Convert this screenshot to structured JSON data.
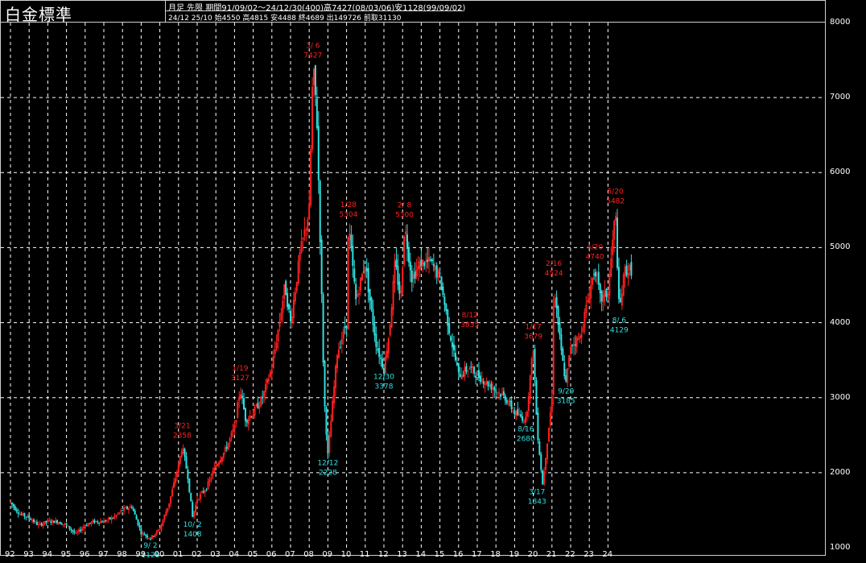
{
  "header": {
    "title": "白金標準",
    "line1": "月足 先限  期間91/09/02～24/12/30(400)高7427(08/03/06)安1128(99/09/02)",
    "line2": "24/12 25/10 始4550 高4815 安4488 終4689 出149726 前取31130"
  },
  "colors": {
    "up": "#ff2020",
    "down": "#30e0e0",
    "grid": "#ffffff",
    "background": "#000000"
  },
  "chart_data": {
    "type": "line",
    "title": "白金標準",
    "ylim": [
      1000,
      8000
    ],
    "y_ticks": [
      1000,
      2000,
      3000,
      4000,
      5000,
      6000,
      7000,
      8000
    ],
    "y_tick_labels": [
      "1000",
      "2000",
      "3000",
      "4000",
      "5000",
      "6000",
      "7000",
      "8000"
    ],
    "x_tick_labels": [
      "92",
      "93",
      "94",
      "95",
      "96",
      "97",
      "98",
      "99",
      "00",
      "01",
      "02",
      "03",
      "04",
      "05",
      "06",
      "07",
      "08",
      "09",
      "10",
      "11",
      "12",
      "13",
      "14",
      "15",
      "16",
      "17",
      "18",
      "19",
      "20",
      "21",
      "22",
      "23",
      "24"
    ],
    "grid": true,
    "series": [
      {
        "x": [
          1992.0,
          1992.5,
          1993.0,
          1993.5,
          1994.0,
          1994.5,
          1995.0,
          1995.5,
          1996.0,
          1996.5,
          1997.0,
          1997.5,
          1998.0,
          1998.5,
          1999.0,
          1999.5,
          2000.0,
          2000.5,
          2001.0,
          2001.2,
          2001.5,
          2001.75,
          2002.0,
          2002.5,
          2003.0,
          2003.5,
          2004.0,
          2004.3,
          2004.6,
          2005.0,
          2005.5,
          2006.0,
          2006.4,
          2006.7,
          2007.0,
          2007.5,
          2008.0,
          2008.2,
          2008.4,
          2008.6,
          2008.8,
          2009.0,
          2009.5,
          2010.0,
          2010.1,
          2010.5,
          2011.0,
          2011.3,
          2011.6,
          2012.0,
          2012.3,
          2012.6,
          2012.9,
          2013.1,
          2013.5,
          2014.0,
          2014.5,
          2015.0,
          2015.5,
          2016.0,
          2016.6,
          2017.0,
          2017.5,
          2018.0,
          2018.5,
          2019.0,
          2019.6,
          2020.0,
          2020.2,
          2020.5,
          2021.0,
          2021.1,
          2021.5,
          2021.75,
          2022.0,
          2022.5,
          2023.0,
          2023.3,
          2023.6,
          2024.0,
          2024.4,
          2024.6,
          2024.9
        ],
        "y": [
          1600,
          1450,
          1400,
          1300,
          1350,
          1350,
          1300,
          1180,
          1300,
          1350,
          1350,
          1400,
          1500,
          1550,
          1200,
          1128,
          1250,
          1600,
          2100,
          2358,
          1950,
          1408,
          1650,
          1800,
          2100,
          2300,
          2600,
          3127,
          2700,
          2800,
          3000,
          3400,
          4000,
          4500,
          4000,
          4900,
          5500,
          7427,
          6800,
          5000,
          3000,
          2228,
          3600,
          4000,
          5304,
          4300,
          4800,
          4200,
          3700,
          3378,
          3900,
          4800,
          4300,
          5300,
          4600,
          4800,
          4800,
          4600,
          3900,
          3300,
          3400,
          3300,
          3200,
          3100,
          3000,
          2800,
          2700,
          3679,
          2600,
          1843,
          3000,
          4524,
          3600,
          3185,
          3700,
          3800,
          4400,
          4740,
          4300,
          4400,
          5482,
          4129,
          4700
        ]
      }
    ],
    "annotations": [
      {
        "date": "3/21",
        "value": "2358",
        "color": "red",
        "x": 2001.2,
        "y": 2358
      },
      {
        "date": "10/ 2",
        "value": "1408",
        "color": "cyan",
        "x": 2001.75,
        "y": 1408
      },
      {
        "date": "1/19",
        "value": "3127",
        "color": "red",
        "x": 2004.3,
        "y": 3127
      },
      {
        "date": "3/ 6",
        "value": "7427",
        "color": "red",
        "x": 2008.2,
        "y": 7427
      },
      {
        "date": "12/12",
        "value": "2228",
        "color": "cyan",
        "x": 2009.0,
        "y": 2228
      },
      {
        "date": "1/28",
        "value": "5304",
        "color": "red",
        "x": 2010.1,
        "y": 5304
      },
      {
        "date": "12/30",
        "value": "3378",
        "color": "cyan",
        "x": 2012.0,
        "y": 3378
      },
      {
        "date": "2/ 8",
        "value": "5300",
        "color": "red",
        "x": 2013.1,
        "y": 5300
      },
      {
        "date": "8/12",
        "value": "3835",
        "color": "red",
        "x": 2016.6,
        "y": 3835
      },
      {
        "date": "8/16",
        "value": "2680",
        "color": "cyan",
        "x": 2019.6,
        "y": 2680
      },
      {
        "date": "1/17",
        "value": "3679",
        "color": "red",
        "x": 2020.0,
        "y": 3679
      },
      {
        "date": "3/17",
        "value": "1843",
        "color": "cyan",
        "x": 2020.2,
        "y": 1843
      },
      {
        "date": "2/16",
        "value": "4524",
        "color": "red",
        "x": 2021.1,
        "y": 4524
      },
      {
        "date": "9/29",
        "value": "3185",
        "color": "cyan",
        "x": 2021.75,
        "y": 3185
      },
      {
        "date": "4/20",
        "value": "4740",
        "color": "red",
        "x": 2023.3,
        "y": 4740
      },
      {
        "date": "5/20",
        "value": "5482",
        "color": "red",
        "x": 2024.4,
        "y": 5482
      },
      {
        "date": "8/ 6",
        "value": "4129",
        "color": "cyan",
        "x": 2024.6,
        "y": 4129
      },
      {
        "date": "9/ 2",
        "value": "1128",
        "color": "cyan",
        "x": 1999.5,
        "y": 1128
      }
    ]
  }
}
